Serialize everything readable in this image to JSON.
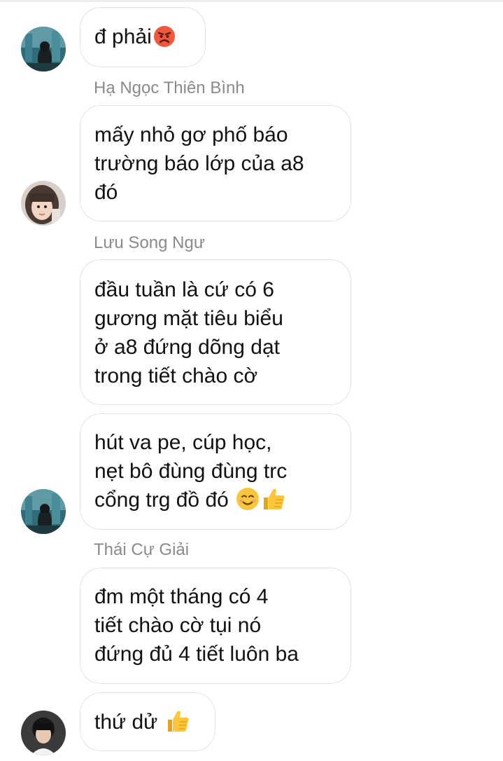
{
  "messages": [
    {
      "sender": "",
      "lines": [
        "đ phải"
      ],
      "emoji_after": "angry-face"
    },
    {
      "sender": "Hạ Ngọc Thiên Bình",
      "lines": [
        "mấy nhỏ gơ phố báo",
        "trường báo lớp của a8",
        "đó"
      ]
    },
    {
      "sender": "Lưu Song Ngư",
      "lines": [
        "đầu tuần là cứ có 6",
        "gương mặt tiêu biểu",
        "ở a8 đứng dõng dạt",
        "trong tiết chào cờ"
      ]
    },
    {
      "sender": "",
      "lines": [
        "hút va pe, cúp học,",
        "nẹt bô đùng đùng trc",
        "cổng trg đồ đó "
      ],
      "emoji_after": [
        "smiling-face",
        "thumbs-up"
      ]
    },
    {
      "sender": "Thái Cự Giải",
      "lines": [
        "đm một tháng có 4",
        "tiết chào cờ tụi nó",
        "đứng đủ 4 tiết luôn ba"
      ]
    },
    {
      "sender": "",
      "lines": [
        "thứ dử "
      ],
      "emoji_after": "thumbs-up"
    }
  ],
  "colors": {
    "bubble_border": "#e3e3e3",
    "sender_text": "#8a8a8a",
    "message_text": "#111111",
    "background": "#ffffff"
  }
}
